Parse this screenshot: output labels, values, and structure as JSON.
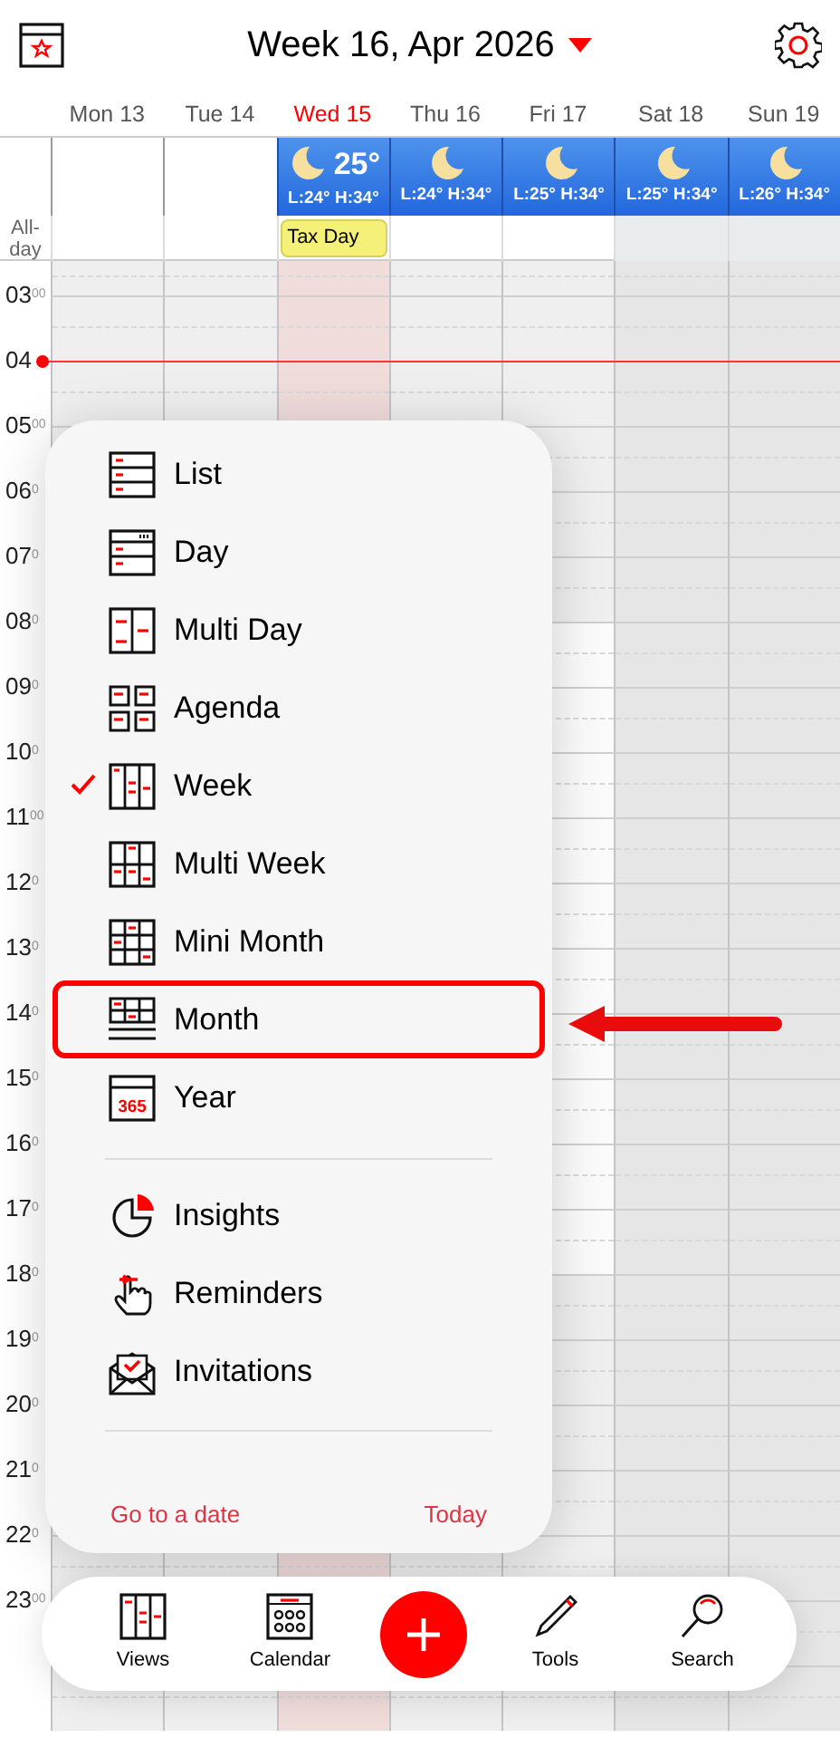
{
  "header": {
    "title": "Week 16, Apr 2026"
  },
  "all_day_label": "All-day",
  "days": [
    {
      "label": "Mon 13",
      "today": false,
      "weekend": false
    },
    {
      "label": "Tue 14",
      "today": false,
      "weekend": false
    },
    {
      "label": "Wed 15",
      "today": true,
      "weekend": false,
      "weather": {
        "temp": "25°",
        "range": "L:24° H:34°"
      },
      "all_day": [
        "Tax Day"
      ]
    },
    {
      "label": "Thu 16",
      "today": false,
      "weekend": false,
      "weather": {
        "range": "L:24° H:34°"
      }
    },
    {
      "label": "Fri 17",
      "today": false,
      "weekend": false,
      "weather": {
        "range": "L:25° H:34°"
      }
    },
    {
      "label": "Sat 18",
      "today": false,
      "weekend": true,
      "weather": {
        "range": "L:25° H:34°"
      }
    },
    {
      "label": "Sun 19",
      "today": false,
      "weekend": true,
      "weather": {
        "range": "L:26° H:34°"
      }
    }
  ],
  "hours": [
    {
      "label": "03$^{00}$",
      "work": false,
      "now": false
    },
    {
      "label": "04",
      "work": false,
      "now": true
    },
    {
      "label": "05$^{00}$",
      "work": false,
      "now": false
    },
    {
      "label": "06$^{0}$",
      "work": false,
      "now": false
    },
    {
      "label": "07$^{0}$",
      "work": false,
      "now": false
    },
    {
      "label": "08$^{0}$",
      "work": true,
      "now": false
    },
    {
      "label": "09$^{0}$",
      "work": true,
      "now": false
    },
    {
      "label": "10$^{0}$",
      "work": true,
      "now": false
    },
    {
      "label": "11$^{00}$",
      "work": true,
      "now": false
    },
    {
      "label": "12$^{0}$",
      "work": true,
      "now": false
    },
    {
      "label": "13$^{0}$",
      "work": true,
      "now": false
    },
    {
      "label": "14$^{0}$",
      "work": true,
      "now": false
    },
    {
      "label": "15$^{0}$",
      "work": true,
      "now": false
    },
    {
      "label": "16$^{0}$",
      "work": true,
      "now": false
    },
    {
      "label": "17$^{0}$",
      "work": true,
      "now": false
    },
    {
      "label": "18$^{0}$",
      "work": false,
      "now": false
    },
    {
      "label": "19$^{0}$",
      "work": false,
      "now": false
    },
    {
      "label": "20$^{0}$",
      "work": false,
      "now": false
    },
    {
      "label": "21$^{0}$",
      "work": false,
      "now": false
    },
    {
      "label": "22$^{0}$",
      "work": false,
      "now": false
    },
    {
      "label": "23$^{00}$",
      "work": false,
      "now": false
    }
  ],
  "menu": {
    "views": [
      {
        "label": "List",
        "kind": "list",
        "checked": false,
        "highlighted": false
      },
      {
        "label": "Day",
        "kind": "day",
        "checked": false,
        "highlighted": false
      },
      {
        "label": "Multi Day",
        "kind": "multiday",
        "checked": false,
        "highlighted": false
      },
      {
        "label": "Agenda",
        "kind": "agenda",
        "checked": false,
        "highlighted": false
      },
      {
        "label": "Week",
        "kind": "week",
        "checked": true,
        "highlighted": false
      },
      {
        "label": "Multi Week",
        "kind": "multiweek",
        "checked": false,
        "highlighted": false
      },
      {
        "label": "Mini Month",
        "kind": "minimonth",
        "checked": false,
        "highlighted": false
      },
      {
        "label": "Month",
        "kind": "month",
        "checked": false,
        "highlighted": true
      },
      {
        "label": "Year",
        "kind": "year",
        "checked": false,
        "highlighted": false,
        "icon_text": "365"
      }
    ],
    "tools": [
      {
        "label": "Insights",
        "kind": "insights"
      },
      {
        "label": "Reminders",
        "kind": "reminders"
      },
      {
        "label": "Invitations",
        "kind": "invitations"
      }
    ],
    "go_to_date": "Go to a date",
    "today": "Today"
  },
  "toolbar": [
    {
      "kind": "views",
      "label": "Views"
    },
    {
      "kind": "calendar",
      "label": "Calendar"
    },
    {
      "kind": "add"
    },
    {
      "kind": "tools",
      "label": "Tools"
    },
    {
      "kind": "search",
      "label": "Search"
    }
  ]
}
